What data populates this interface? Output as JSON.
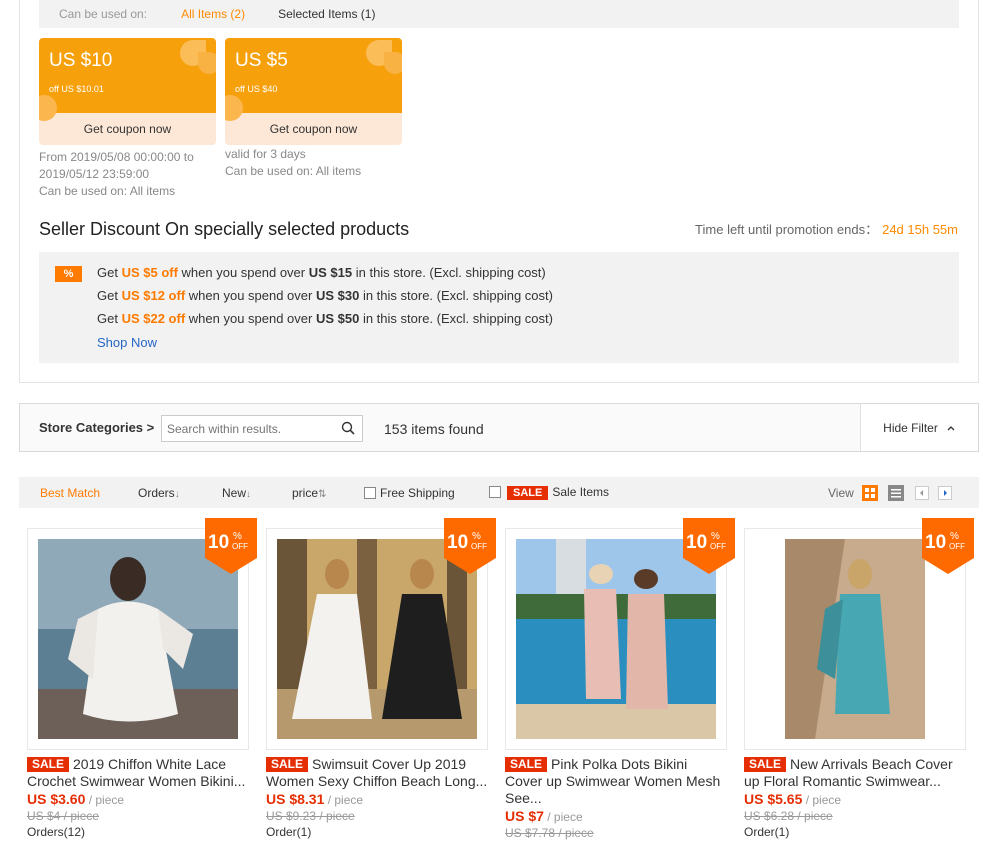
{
  "usage_bar": {
    "label": "Can be used on:",
    "all_items": "All Items (2)",
    "selected_items": "Selected Items (1)"
  },
  "coupons": [
    {
      "amount": "US $10",
      "condition": "off US $10.01",
      "button": "Get coupon now",
      "meta1": "From 2019/05/08 00:00:00 to",
      "meta2": "2019/05/12 23:59:00",
      "meta3": "Can be used on: All items"
    },
    {
      "amount": "US $5",
      "condition": "off US $40",
      "button": "Get coupon now",
      "meta1": "valid for 3 days",
      "meta2": "Can be used on: All items",
      "meta3": ""
    }
  ],
  "discount": {
    "title": "Seller Discount On specially selected products",
    "time_label": "Time left until promotion ends：",
    "time_value": "24d 15h 55m",
    "badge": "%",
    "lines": [
      {
        "pre": "Get ",
        "off": "US $5 off",
        "mid": " when you spend over ",
        "min": "US $15",
        "post": " in this store. (Excl. shipping cost)"
      },
      {
        "pre": "Get ",
        "off": "US $12 off",
        "mid": " when you spend over ",
        "min": "US $30",
        "post": " in this store. (Excl. shipping cost)"
      },
      {
        "pre": "Get ",
        "off": "US $22 off",
        "mid": " when you spend over ",
        "min": "US $50",
        "post": " in this store. (Excl. shipping cost)"
      }
    ],
    "shop_now": "Shop Now"
  },
  "search": {
    "categories": "Store Categories >",
    "placeholder": "Search within results.",
    "found": "153 items found",
    "hide_filter": "Hide Filter"
  },
  "sort": {
    "best_match": "Best Match",
    "orders": "Orders",
    "new": "New",
    "price": "price",
    "free_shipping": "Free Shipping",
    "sale_tag": "SALE",
    "sale_items": "Sale Items",
    "view": "View"
  },
  "products": [
    {
      "badge_num": "10",
      "badge_pct": "%",
      "badge_off": "OFF",
      "sale": "SALE",
      "title": "2019 Chiffon White Lace Crochet Swimwear Women Bikini...",
      "price": "US $3.60",
      "unit": " / piece",
      "orig": "US $4 / piece",
      "orders": "Orders(12)"
    },
    {
      "badge_num": "10",
      "badge_pct": "%",
      "badge_off": "OFF",
      "sale": "SALE",
      "title": "Swimsuit Cover Up 2019 Women Sexy Chiffon Beach Long...",
      "price": "US $8.31",
      "unit": " / piece",
      "orig": "US $9.23 / piece",
      "orders": "Order(1)"
    },
    {
      "badge_num": "10",
      "badge_pct": "%",
      "badge_off": "OFF",
      "sale": "SALE",
      "title": "Pink Polka Dots Bikini Cover up Swimwear Women Mesh See...",
      "price": "US $7",
      "unit": " / piece",
      "orig": "US $7.78 / piece",
      "orders": ""
    },
    {
      "badge_num": "10",
      "badge_pct": "%",
      "badge_off": "OFF",
      "sale": "SALE",
      "title": "New Arrivals Beach Cover up Floral Romantic Swimwear...",
      "price": "US $5.65",
      "unit": " / piece",
      "orig": "US $6.28 / piece",
      "orders": "Order(1)"
    }
  ],
  "colors": {
    "accent": "#ff7a00",
    "sale": "#e62e04",
    "coupon": "#f6a00c",
    "link": "#2766c6"
  }
}
